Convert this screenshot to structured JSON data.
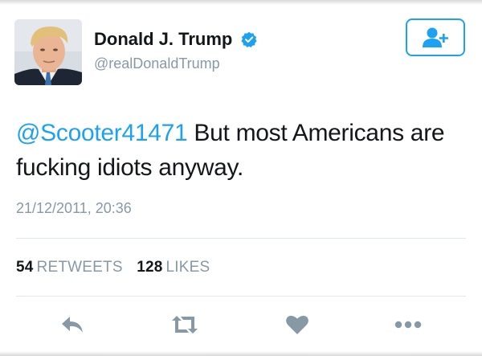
{
  "user": {
    "display_name": "Donald J. Trump",
    "handle": "@realDonaldTrump",
    "verified": true,
    "avatar_icon": "profile-photo"
  },
  "follow_button": {
    "icon": "add-user-icon"
  },
  "tweet": {
    "mention": "@Scooter41471",
    "text": " But most Americans are fucking idiots anyway.",
    "timestamp": "21/12/2011, 20:36"
  },
  "stats": {
    "retweets_count": "54",
    "retweets_label": "RETWEETS",
    "likes_count": "128",
    "likes_label": "LIKES"
  },
  "actions": [
    {
      "icon": "reply-icon"
    },
    {
      "icon": "retweet-icon"
    },
    {
      "icon": "heart-icon"
    },
    {
      "icon": "more-icon"
    }
  ],
  "colors": {
    "accent": "#1da1f2",
    "muted": "#8899a6",
    "text": "#14171a",
    "divider": "#e1e8ed",
    "icon": "#8899a6"
  }
}
